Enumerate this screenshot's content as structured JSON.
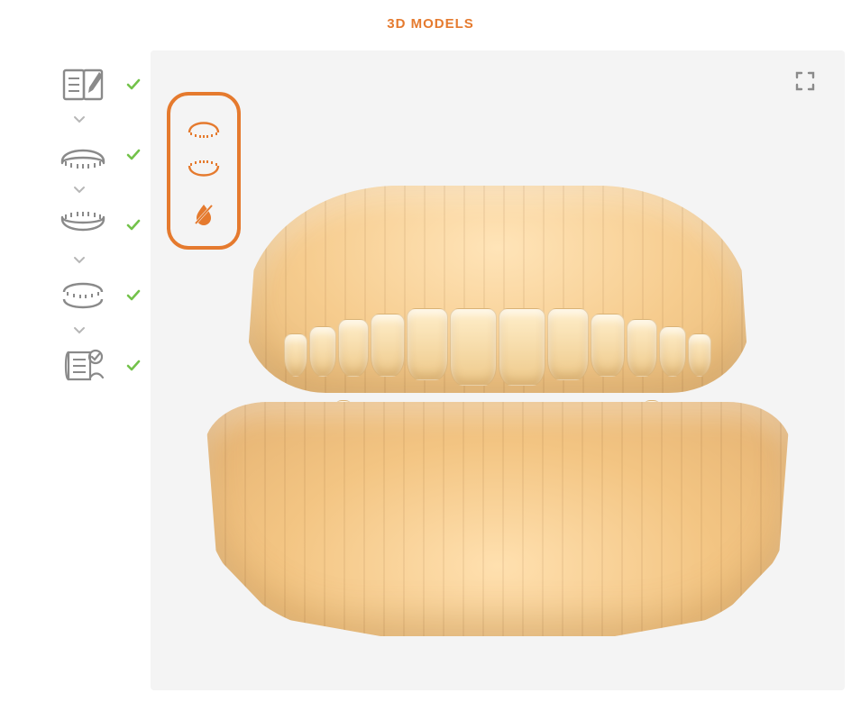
{
  "header": {
    "title": "3D MODELS"
  },
  "colors": {
    "accent": "#E57A2E",
    "success": "#73C24A",
    "panel": "#F4F4F4",
    "iconGrey": "#8A8A8A"
  },
  "sidebar": {
    "steps": [
      {
        "name": "patient-form",
        "icon": "form-pencil-icon",
        "complete": true
      },
      {
        "name": "upper-jaw",
        "icon": "upper-jaw-icon",
        "complete": true
      },
      {
        "name": "lower-jaw",
        "icon": "lower-jaw-icon",
        "complete": true
      },
      {
        "name": "bite",
        "icon": "bite-icon",
        "complete": true
      },
      {
        "name": "review",
        "icon": "review-checklist-icon",
        "complete": true
      }
    ]
  },
  "viewer": {
    "fullscreen_tooltip": "Fullscreen",
    "toolbox": {
      "tools": [
        {
          "name": "toggle-upper-jaw",
          "icon": "upper-arch-icon",
          "active": true
        },
        {
          "name": "toggle-lower-jaw",
          "icon": "lower-arch-icon",
          "active": true
        },
        {
          "name": "toggle-color-overlay",
          "icon": "no-color-icon",
          "active": true
        }
      ]
    },
    "model": {
      "description": "Upper and lower dental arch 3D scan, frontal view, matte beige material",
      "upper_visible": true,
      "lower_visible": true,
      "color_overlay": false
    }
  }
}
